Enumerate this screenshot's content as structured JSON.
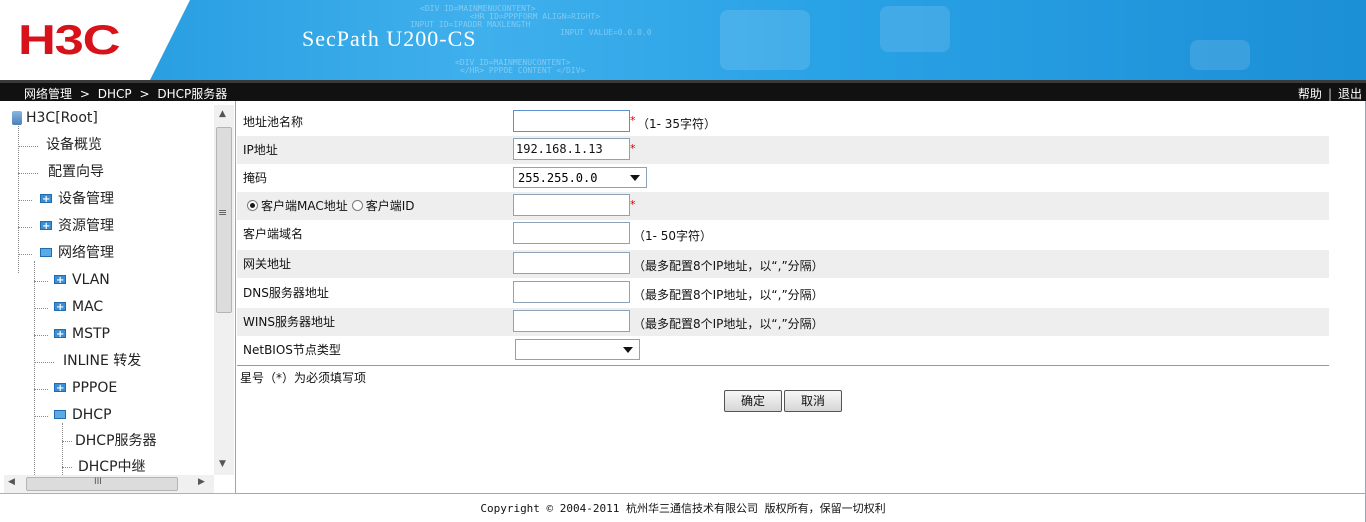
{
  "header": {
    "logo_text": "H3C",
    "product_name": "SecPath U200-CS",
    "watermark_lines": [
      "<DIV ID=MAINMENUCONTENT>",
      "<HR ID=PPPFORM ALIGN=RIGHT>",
      "INPUT ID=IPADDR MAXLENGTH",
      "INPUT VALUE=0.0.0.0",
      "<DIV ID=MAINMENUCONTENT>",
      "</HR> PPPOE CONTENT </DIV>"
    ]
  },
  "navbar": {
    "breadcrumb": [
      "网络管理",
      "DHCP",
      "DHCP服务器"
    ],
    "breadcrumb_sep": ">",
    "help_label": "帮助",
    "logout_label": "退出",
    "link_sep": "|"
  },
  "sidebar": {
    "root_label": "H3C[Root]",
    "items": [
      {
        "label": "设备概览",
        "icon": "none"
      },
      {
        "label": "配置向导",
        "icon": "none"
      },
      {
        "label": "设备管理",
        "icon": "folder-plus-icon"
      },
      {
        "label": "资源管理",
        "icon": "folder-plus-icon"
      },
      {
        "label": "网络管理",
        "icon": "folder-open-icon"
      },
      {
        "label": "VLAN",
        "icon": "folder-plus-icon"
      },
      {
        "label": "MAC",
        "icon": "folder-plus-icon"
      },
      {
        "label": "MSTP",
        "icon": "folder-plus-icon"
      },
      {
        "label": "INLINE 转发",
        "icon": "none"
      },
      {
        "label": "PPPOE",
        "icon": "folder-plus-icon"
      },
      {
        "label": "DHCP",
        "icon": "folder-open-icon"
      },
      {
        "label": "DHCP服务器",
        "icon": "none"
      },
      {
        "label": "DHCP中继",
        "icon": "none"
      }
    ],
    "scroll_up": "▲",
    "scroll_down": "▼",
    "scroll_left": "◀",
    "scroll_right": "▶",
    "hgrip": "III",
    "vgrip": "≡"
  },
  "form": {
    "pool_name": {
      "label": "地址池名称",
      "value": "",
      "required": "*",
      "hint": "（1- 35字符）"
    },
    "ip": {
      "label": "IP地址",
      "value": "192.168.1.13",
      "required": "*"
    },
    "mask": {
      "label": "掩码",
      "value": "255.255.0.0"
    },
    "client_id_type": {
      "option_mac": "客户端MAC地址",
      "option_id": "客户端ID",
      "selected": "客户端MAC地址",
      "value": "",
      "required": "*"
    },
    "client_domain": {
      "label": "客户端域名",
      "value": "",
      "hint": "（1- 50字符）"
    },
    "gateway": {
      "label": "网关地址",
      "value": "",
      "hint": "（最多配置8个IP地址，以“,”分隔）"
    },
    "dns": {
      "label": "DNS服务器地址",
      "value": "",
      "hint": "（最多配置8个IP地址，以“,”分隔）"
    },
    "wins": {
      "label": "WINS服务器地址",
      "value": "",
      "hint": "（最多配置8个IP地址，以“,”分隔）"
    },
    "netbios": {
      "label": "NetBIOS节点类型",
      "value": ""
    },
    "required_note": "星号（*）为必须填写项",
    "ok_label": "确定",
    "cancel_label": "取消"
  },
  "footer": {
    "copyright": "Copyright © 2004-2011 杭州华三通信技术有限公司 版权所有，保留一切权利"
  },
  "colors": {
    "header_blue": "#1b8fd8",
    "logo_red": "#d7121a",
    "navbar_black": "#111111",
    "required_red": "#d40000",
    "alt_row": "#eeeeee"
  }
}
